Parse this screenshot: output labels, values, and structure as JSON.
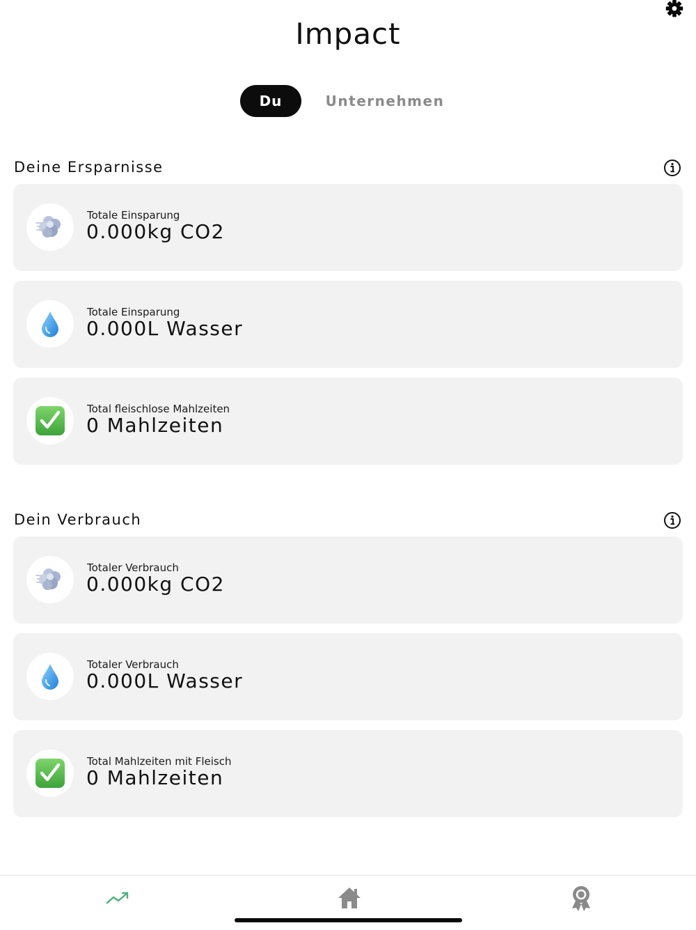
{
  "header": {
    "title": "Impact"
  },
  "tabs": [
    {
      "label": "Du",
      "active": true
    },
    {
      "label": "Unternehmen",
      "active": false
    }
  ],
  "savings": {
    "title": "Deine Ersparnisse",
    "cards": [
      {
        "label": "Totale Einsparung",
        "value": "0.000kg CO2",
        "icon": "cloud-icon"
      },
      {
        "label": "Totale Einsparung",
        "value": "0.000L Wasser",
        "icon": "water-drop-icon"
      },
      {
        "label": "Total fleischlose Mahlzeiten",
        "value": "0 Mahlzeiten",
        "icon": "check-mark-icon"
      }
    ]
  },
  "consumption": {
    "title": "Dein Verbrauch",
    "cards": [
      {
        "label": "Totaler Verbrauch",
        "value": "0.000kg CO2",
        "icon": "cloud-icon"
      },
      {
        "label": "Totaler Verbrauch",
        "value": "0.000L Wasser",
        "icon": "water-drop-icon"
      },
      {
        "label": "Total Mahlzeiten mit Fleisch",
        "value": "0 Mahlzeiten",
        "icon": "check-mark-icon"
      }
    ]
  },
  "bottom_nav": {
    "items": [
      {
        "icon": "trend-icon",
        "active": true
      },
      {
        "icon": "home-icon",
        "active": false
      },
      {
        "icon": "award-icon",
        "active": false
      }
    ]
  },
  "colors": {
    "active_tab_bg": "#0c0c0c",
    "inactive_tab_text": "#8a8a8a",
    "card_bg": "#f2f2f2",
    "active_nav": "#4caf7d",
    "inactive_nav": "#8a8a8a",
    "check_green": "#4cb648",
    "water_blue": "#3aa0e8"
  }
}
